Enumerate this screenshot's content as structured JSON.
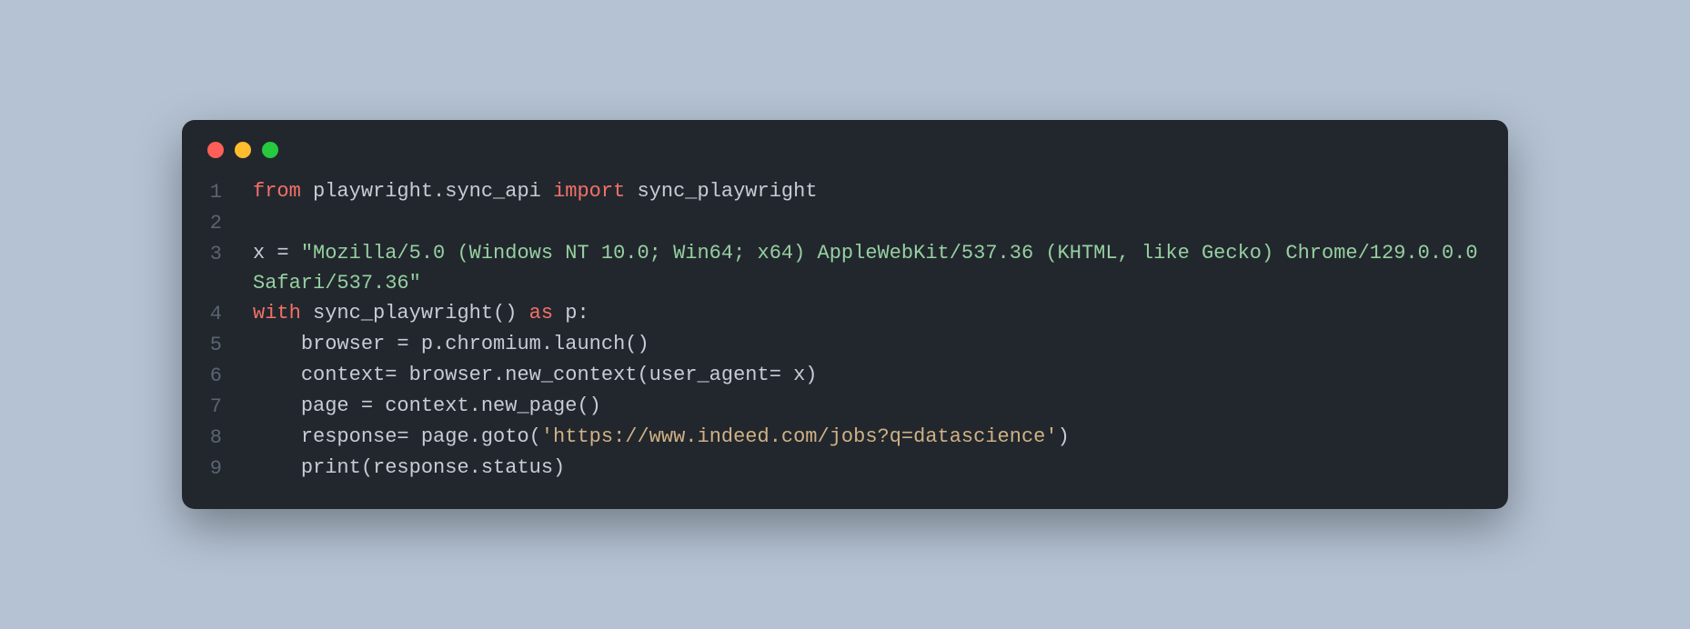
{
  "window": {
    "traffic_lights": [
      "close",
      "minimize",
      "zoom"
    ]
  },
  "code": {
    "lines": [
      {
        "n": "1",
        "tokens": [
          {
            "t": "from ",
            "c": "tok-kw"
          },
          {
            "t": "playwright.sync_api ",
            "c": "tok-id"
          },
          {
            "t": "import ",
            "c": "tok-kw"
          },
          {
            "t": "sync_playwright",
            "c": "tok-id"
          }
        ]
      },
      {
        "n": "2",
        "tokens": []
      },
      {
        "n": "3",
        "tokens": [
          {
            "t": "x = ",
            "c": "tok-id"
          },
          {
            "t": "\"Mozilla/5.0 (Windows NT 10.0; Win64; x64) AppleWebKit/537.36 (KHTML, like Gecko) Chrome/129.0.0.0 Safari/537.36\"",
            "c": "tok-str"
          }
        ]
      },
      {
        "n": "4",
        "tokens": [
          {
            "t": "with ",
            "c": "tok-kw"
          },
          {
            "t": "sync_playwright() ",
            "c": "tok-id"
          },
          {
            "t": "as ",
            "c": "tok-kw"
          },
          {
            "t": "p:",
            "c": "tok-id"
          }
        ]
      },
      {
        "n": "5",
        "tokens": [
          {
            "t": "    browser = p.chromium.launch()",
            "c": "tok-id"
          }
        ]
      },
      {
        "n": "6",
        "tokens": [
          {
            "t": "    context= browser.new_context(user_agent= x)",
            "c": "tok-id"
          }
        ]
      },
      {
        "n": "7",
        "tokens": [
          {
            "t": "    page = context.new_page()",
            "c": "tok-id"
          }
        ]
      },
      {
        "n": "8",
        "tokens": [
          {
            "t": "    response= page.goto(",
            "c": "tok-id"
          },
          {
            "t": "'https://www.indeed.com/jobs?q=datascience'",
            "c": "tok-url"
          },
          {
            "t": ")",
            "c": "tok-id"
          }
        ]
      },
      {
        "n": "9",
        "tokens": [
          {
            "t": "    print(response.status)",
            "c": "tok-id"
          }
        ]
      }
    ]
  }
}
